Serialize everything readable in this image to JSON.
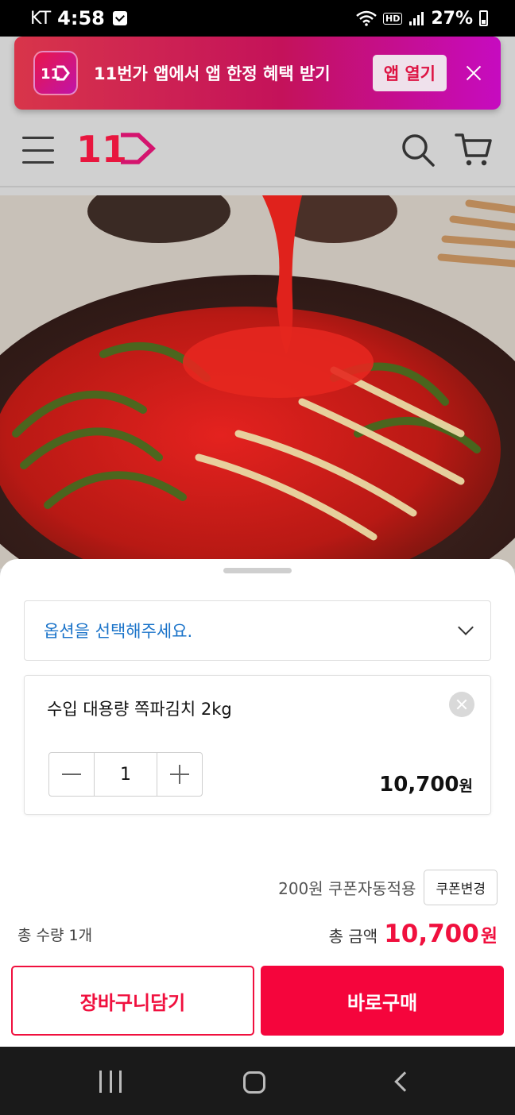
{
  "status_bar": {
    "carrier": "KT",
    "time": "4:58",
    "hd": "HD",
    "battery": "27%"
  },
  "promo_banner": {
    "logo_text": "11",
    "message": "11번가 앱에서 앱 한정 혜택 받기",
    "open_button": "앱 열기"
  },
  "header": {
    "brand_text": "11"
  },
  "sheet": {
    "option_placeholder": "옵션을 선택해주세요.",
    "item": {
      "name": "수입 대용량 쪽파김치 2kg",
      "quantity": "1",
      "price": "10,700",
      "price_unit": "원"
    },
    "coupon": {
      "text": "200원 쿠폰자동적용",
      "button": "쿠폰변경"
    },
    "total": {
      "quantity_label": "총 수량 1개",
      "amount_label": "총 금액",
      "amount": "10,700",
      "amount_unit": "원"
    },
    "buttons": {
      "cart": "장바구니담기",
      "buy": "바로구매"
    }
  },
  "colors": {
    "accent": "#f5053c",
    "link_blue": "#1a73c9"
  }
}
